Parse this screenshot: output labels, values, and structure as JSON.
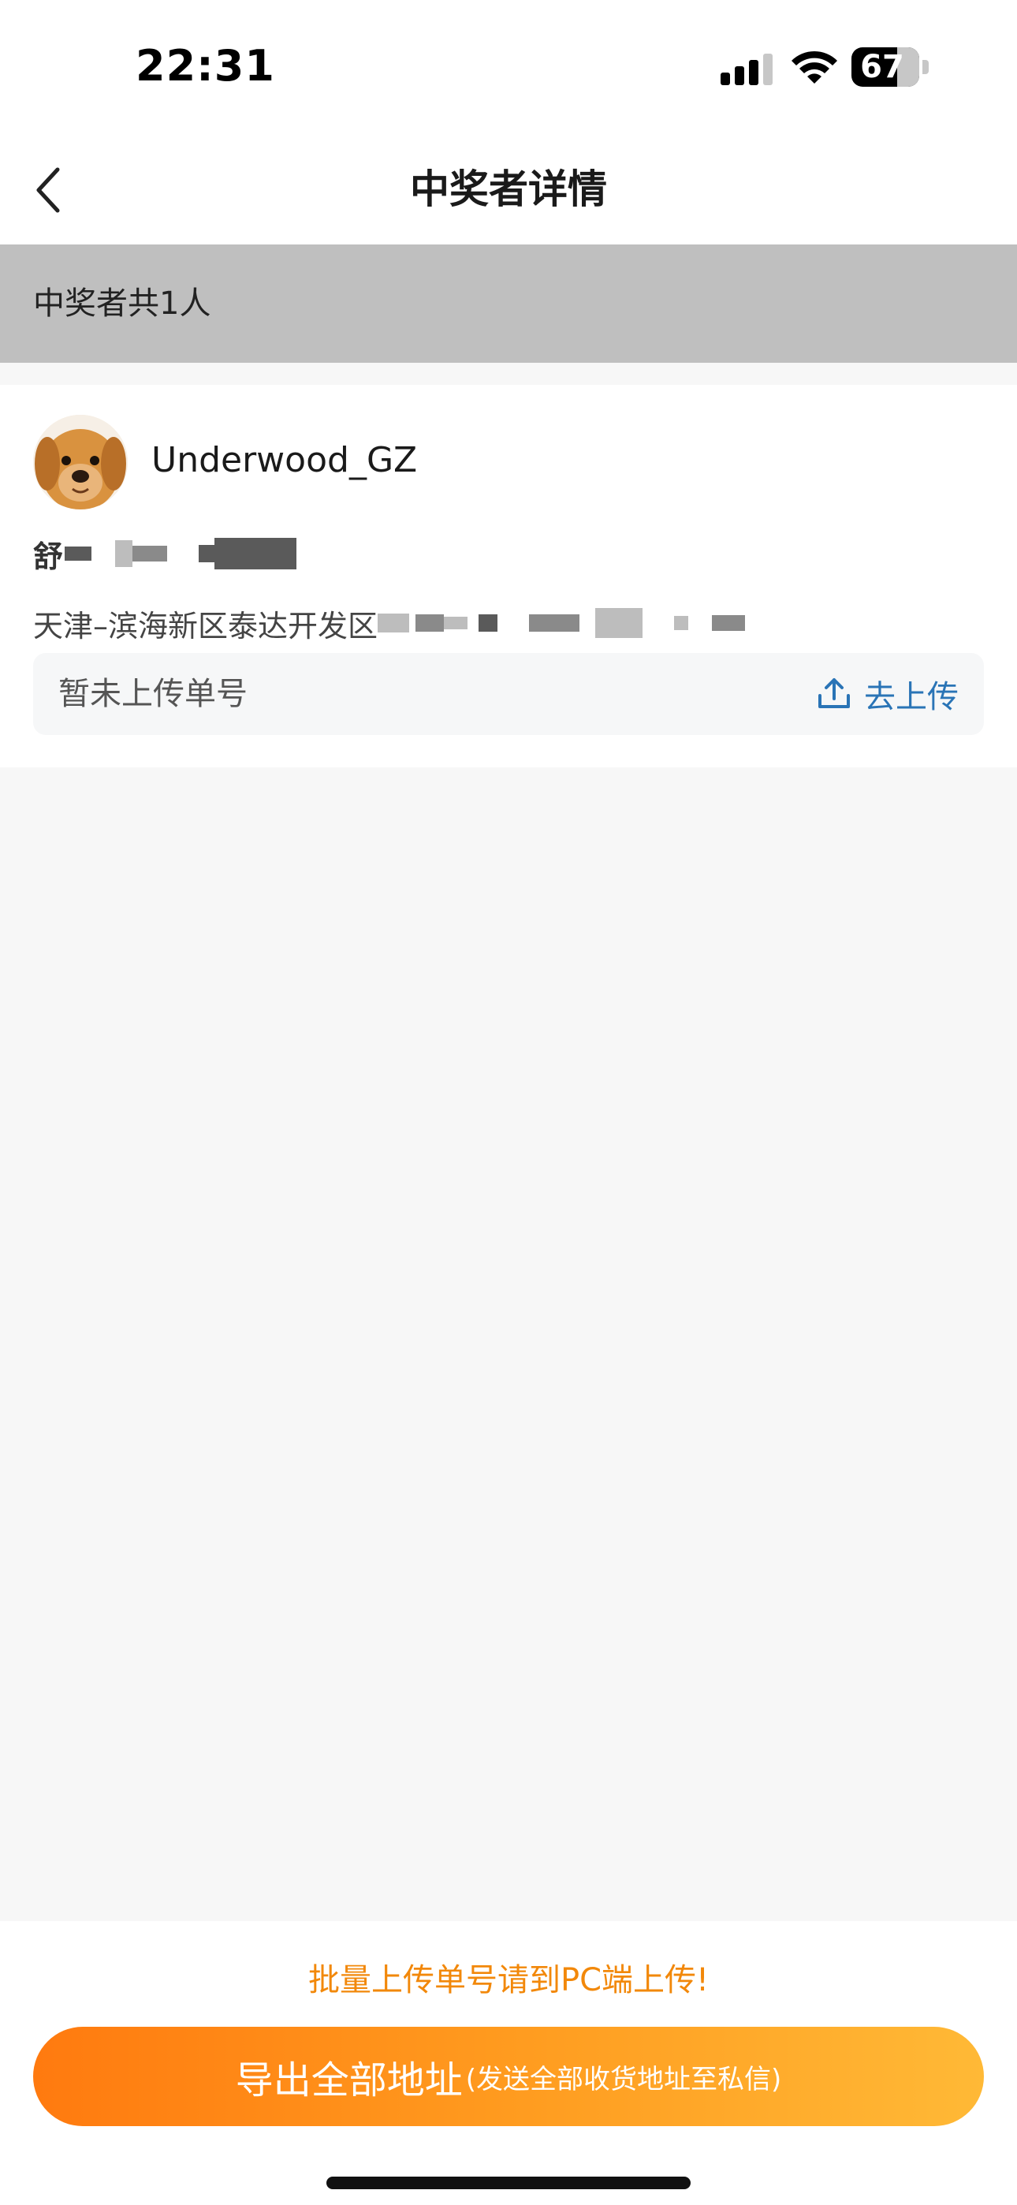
{
  "status_bar": {
    "time": "22:31",
    "battery_level": "67",
    "icons": [
      "signal-icon",
      "wifi-icon",
      "battery-icon"
    ]
  },
  "nav": {
    "title": "中奖者详情",
    "back_icon": "chevron-left-icon"
  },
  "summary": {
    "count_text": "中奖者共1人"
  },
  "winner": {
    "username": "Underwood_GZ",
    "receiver_name_visible": "舒",
    "address_visible": "天津–滨海新区泰达开发区",
    "tracking_status": "暂未上传单号",
    "upload_label": "去上传",
    "upload_icon": "upload-icon"
  },
  "footer": {
    "pc_hint": "批量上传单号请到PC端上传!",
    "export_label": "导出全部地址",
    "export_sub_label": "(发送全部收货地址至私信)"
  },
  "colors": {
    "banner_bg": "#bfbfbf",
    "accent_orange": "#f2880a",
    "link_blue": "#2a74b6",
    "gradient_start": "#ff7a0f",
    "gradient_end": "#ffb936"
  }
}
